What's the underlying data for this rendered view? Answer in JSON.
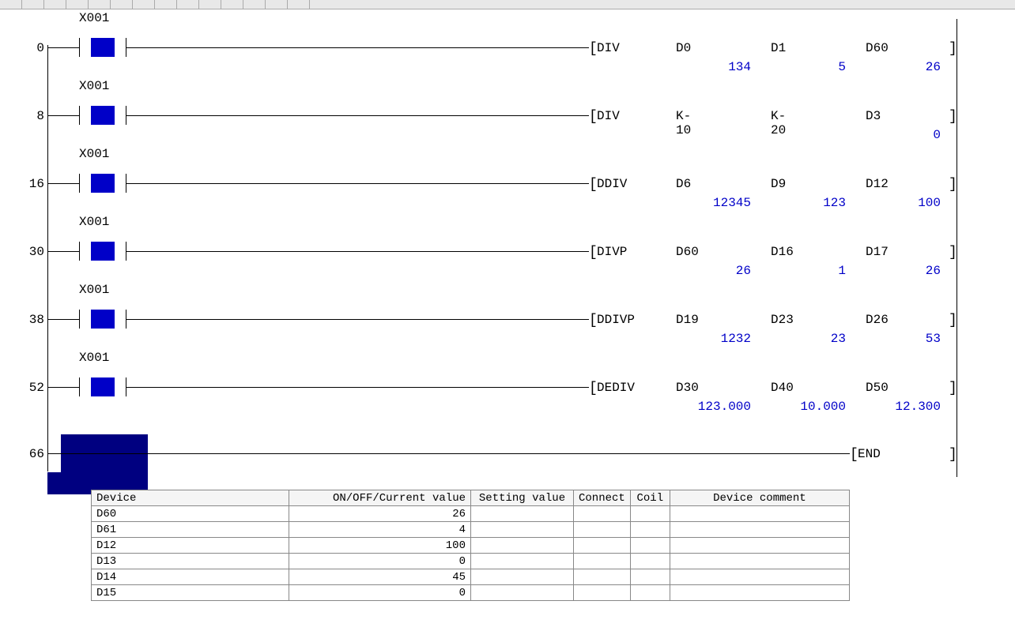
{
  "rungs": [
    {
      "step": "0",
      "contact": "X001",
      "instr": "DIV",
      "ops": [
        "D0",
        "D1",
        "D60"
      ],
      "vals": [
        "134",
        "5",
        "26"
      ]
    },
    {
      "step": "8",
      "contact": "X001",
      "instr": "DIV",
      "ops": [
        "K-10",
        "K-20",
        "D3"
      ],
      "vals": [
        "",
        "",
        "0"
      ]
    },
    {
      "step": "16",
      "contact": "X001",
      "instr": "DDIV",
      "ops": [
        "D6",
        "D9",
        "D12"
      ],
      "vals": [
        "12345",
        "123",
        "100"
      ]
    },
    {
      "step": "30",
      "contact": "X001",
      "instr": "DIVP",
      "ops": [
        "D60",
        "D16",
        "D17"
      ],
      "vals": [
        "26",
        "1",
        "26"
      ]
    },
    {
      "step": "38",
      "contact": "X001",
      "instr": "DDIVP",
      "ops": [
        "D19",
        "D23",
        "D26"
      ],
      "vals": [
        "1232",
        "23",
        "53"
      ]
    },
    {
      "step": "52",
      "contact": "X001",
      "instr": "DEDIV",
      "ops": [
        "D30",
        "D40",
        "D50"
      ],
      "vals": [
        "123.000",
        "10.000",
        "12.300"
      ]
    }
  ],
  "end_rung": {
    "step": "66",
    "instr": "END"
  },
  "table": {
    "headers": {
      "device": "Device",
      "onoff": "ON/OFF/Current value",
      "setting": "Setting value",
      "connect": "Connect",
      "coil": "Coil",
      "comment": "Device comment"
    },
    "rows": [
      {
        "device": "D60",
        "value": "26"
      },
      {
        "device": "D61",
        "value": "4"
      },
      {
        "device": "D12",
        "value": "100"
      },
      {
        "device": "D13",
        "value": "0"
      },
      {
        "device": "D14",
        "value": "45"
      },
      {
        "device": "D15",
        "value": "0"
      }
    ]
  }
}
